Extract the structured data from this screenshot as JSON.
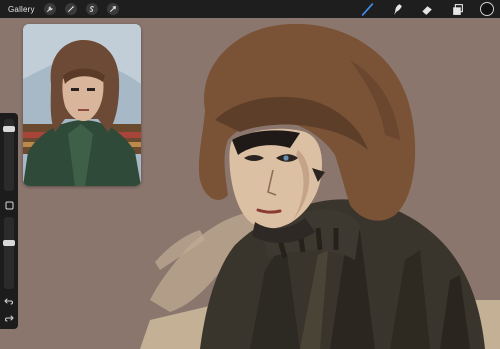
{
  "topbar": {
    "gallery_label": "Gallery",
    "left_icons": [
      "wrench-icon",
      "magic-wand-icon",
      "selection-icon",
      "transform-icon"
    ],
    "right_tools": [
      "brush-icon",
      "smudge-icon",
      "eraser-icon",
      "layers-icon"
    ],
    "active_color": "#111111",
    "brush_color": "#3b8fe6"
  },
  "sidebar": {
    "brush_size": 0.9,
    "opacity": 0.65
  }
}
